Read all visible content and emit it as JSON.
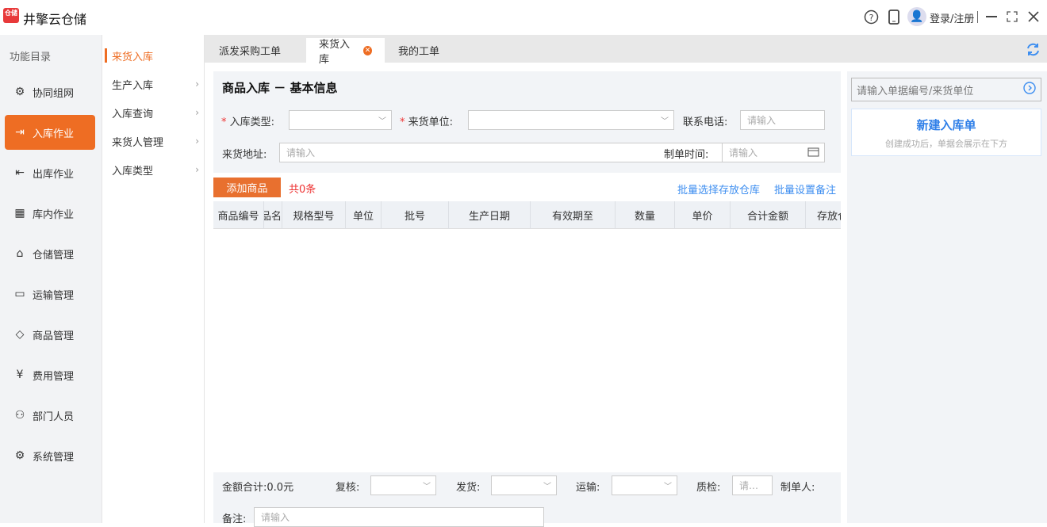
{
  "app": {
    "logo_text": "仓储",
    "title": "井擎云仓储",
    "login_label": "登录/注册"
  },
  "sidebar": {
    "heading": "功能目录",
    "items": [
      {
        "label": "协同组网",
        "icon": "gear-network-icon"
      },
      {
        "label": "入库作业",
        "icon": "arrow-in-icon",
        "active": true
      },
      {
        "label": "出库作业",
        "icon": "arrow-out-icon"
      },
      {
        "label": "库内作业",
        "icon": "grid-icon"
      },
      {
        "label": "仓储管理",
        "icon": "home-icon"
      },
      {
        "label": "运输管理",
        "icon": "bus-icon"
      },
      {
        "label": "商品管理",
        "icon": "box-icon"
      },
      {
        "label": "费用管理",
        "icon": "yen-icon"
      },
      {
        "label": "部门人员",
        "icon": "users-icon"
      },
      {
        "label": "系统管理",
        "icon": "gear-icon"
      }
    ]
  },
  "submenu": {
    "items": [
      {
        "label": "来货入库",
        "active": true
      },
      {
        "label": "生产入库"
      },
      {
        "label": "入库查询"
      },
      {
        "label": "来货人管理"
      },
      {
        "label": "入库类型"
      }
    ]
  },
  "tabs": [
    {
      "label": "派发采购工单"
    },
    {
      "label": "来货入库",
      "active": true
    },
    {
      "label": "我的工单"
    }
  ],
  "form": {
    "title": "商品入库 － 基本信息",
    "type_label": "入库类型:",
    "supplier_label": "来货单位:",
    "phone_label": "联系电话:",
    "phone_placeholder": "请输入",
    "address_label": "来货地址:",
    "address_placeholder": "请输入",
    "time_label": "制单时间:",
    "time_placeholder": "请输入",
    "required_mark": "*"
  },
  "toolbar": {
    "add_label": "添加商品",
    "count": "共0条",
    "batch_warehouse": "批量选择存放仓库",
    "batch_remark": "批量设置备注"
  },
  "table": {
    "columns": [
      "商品编号",
      "品名",
      "规格型号",
      "单位",
      "批号",
      "生产日期",
      "有效期至",
      "数量",
      "单价",
      "合计金额",
      "存放仓库"
    ]
  },
  "footer": {
    "total_label": "金额合计:",
    "total_value": "0.0元",
    "review_label": "复核:",
    "ship_label": "发货:",
    "transport_label": "运输:",
    "qc_label": "质检:",
    "qc_placeholder": "请…",
    "maker_label": "制单人:",
    "remark_label": "备注:",
    "remark_placeholder": "请输入"
  },
  "right": {
    "search_placeholder": "请输入单据编号/来货单位",
    "new_title": "新建入库单",
    "new_hint": "创建成功后，单据会展示在下方"
  }
}
